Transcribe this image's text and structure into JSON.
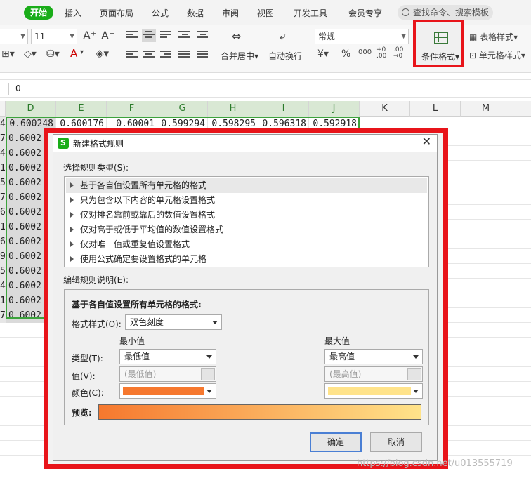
{
  "ribbon": {
    "tabs": [
      "开始",
      "插入",
      "页面布局",
      "公式",
      "数据",
      "审阅",
      "视图",
      "开发工具",
      "会员专享"
    ],
    "search_placeholder": "查找命令、搜索模板"
  },
  "toolbar": {
    "font_size": "11",
    "merge_center": "合并居中",
    "wrap_text": "自动换行",
    "number_format": "常规",
    "conditional_format": "条件格式",
    "table_style": "表格样式",
    "cell_style": "单元格样式",
    "highlight_color": "#e8141a"
  },
  "formula_bar": {
    "value": "0"
  },
  "grid": {
    "columns": [
      "D",
      "E",
      "F",
      "G",
      "H",
      "I",
      "J",
      "K",
      "L",
      "M"
    ],
    "first_row": [
      "0.600248",
      "0.600176",
      "0.60001",
      "0.599294",
      "0.598295",
      "0.596318",
      "0.592918"
    ],
    "row_stubs": [
      "4",
      "7",
      "4",
      "1",
      "5",
      "7",
      "6",
      "1",
      "6",
      "9",
      "5",
      "4",
      "1",
      "7",
      "7",
      "4"
    ],
    "column_d": [
      "0.600248",
      "0.6002",
      "0.6002",
      "0.6002",
      "0.6002",
      "0.6002",
      "0.6002",
      "0.6002",
      "0.6002",
      "0.6002",
      "0.6002",
      "0.6002",
      "0.6002",
      "0.6002",
      "0.6002",
      "0.6002"
    ]
  },
  "dialog": {
    "title": "新建格式规则",
    "close": "✕",
    "select_rule_type_label": "选择规则类型(S):",
    "rule_types": [
      "基于各自值设置所有单元格的格式",
      "只为包含以下内容的单元格设置格式",
      "仅对排名靠前或靠后的数值设置格式",
      "仅对高于或低于平均值的数值设置格式",
      "仅对唯一值或重复值设置格式",
      "使用公式确定要设置格式的单元格"
    ],
    "edit_desc_label": "编辑规则说明(E):",
    "edit_heading": "基于各自值设置所有单元格的格式:",
    "format_style_label": "格式样式(O):",
    "format_style_value": "双色刻度",
    "min_header": "最小值",
    "max_header": "最大值",
    "type_label": "类型(T):",
    "value_label": "值(V):",
    "color_label": "颜色(C):",
    "min_type": "最低值",
    "max_type": "最高值",
    "min_value_placeholder": "(最低值)",
    "max_value_placeholder": "(最高值)",
    "min_color": "#f6782e",
    "max_color": "#ffe38a",
    "preview_label": "预览:",
    "ok": "确定",
    "cancel": "取消"
  },
  "watermark": "https://blog.csdn.net/u013555719"
}
